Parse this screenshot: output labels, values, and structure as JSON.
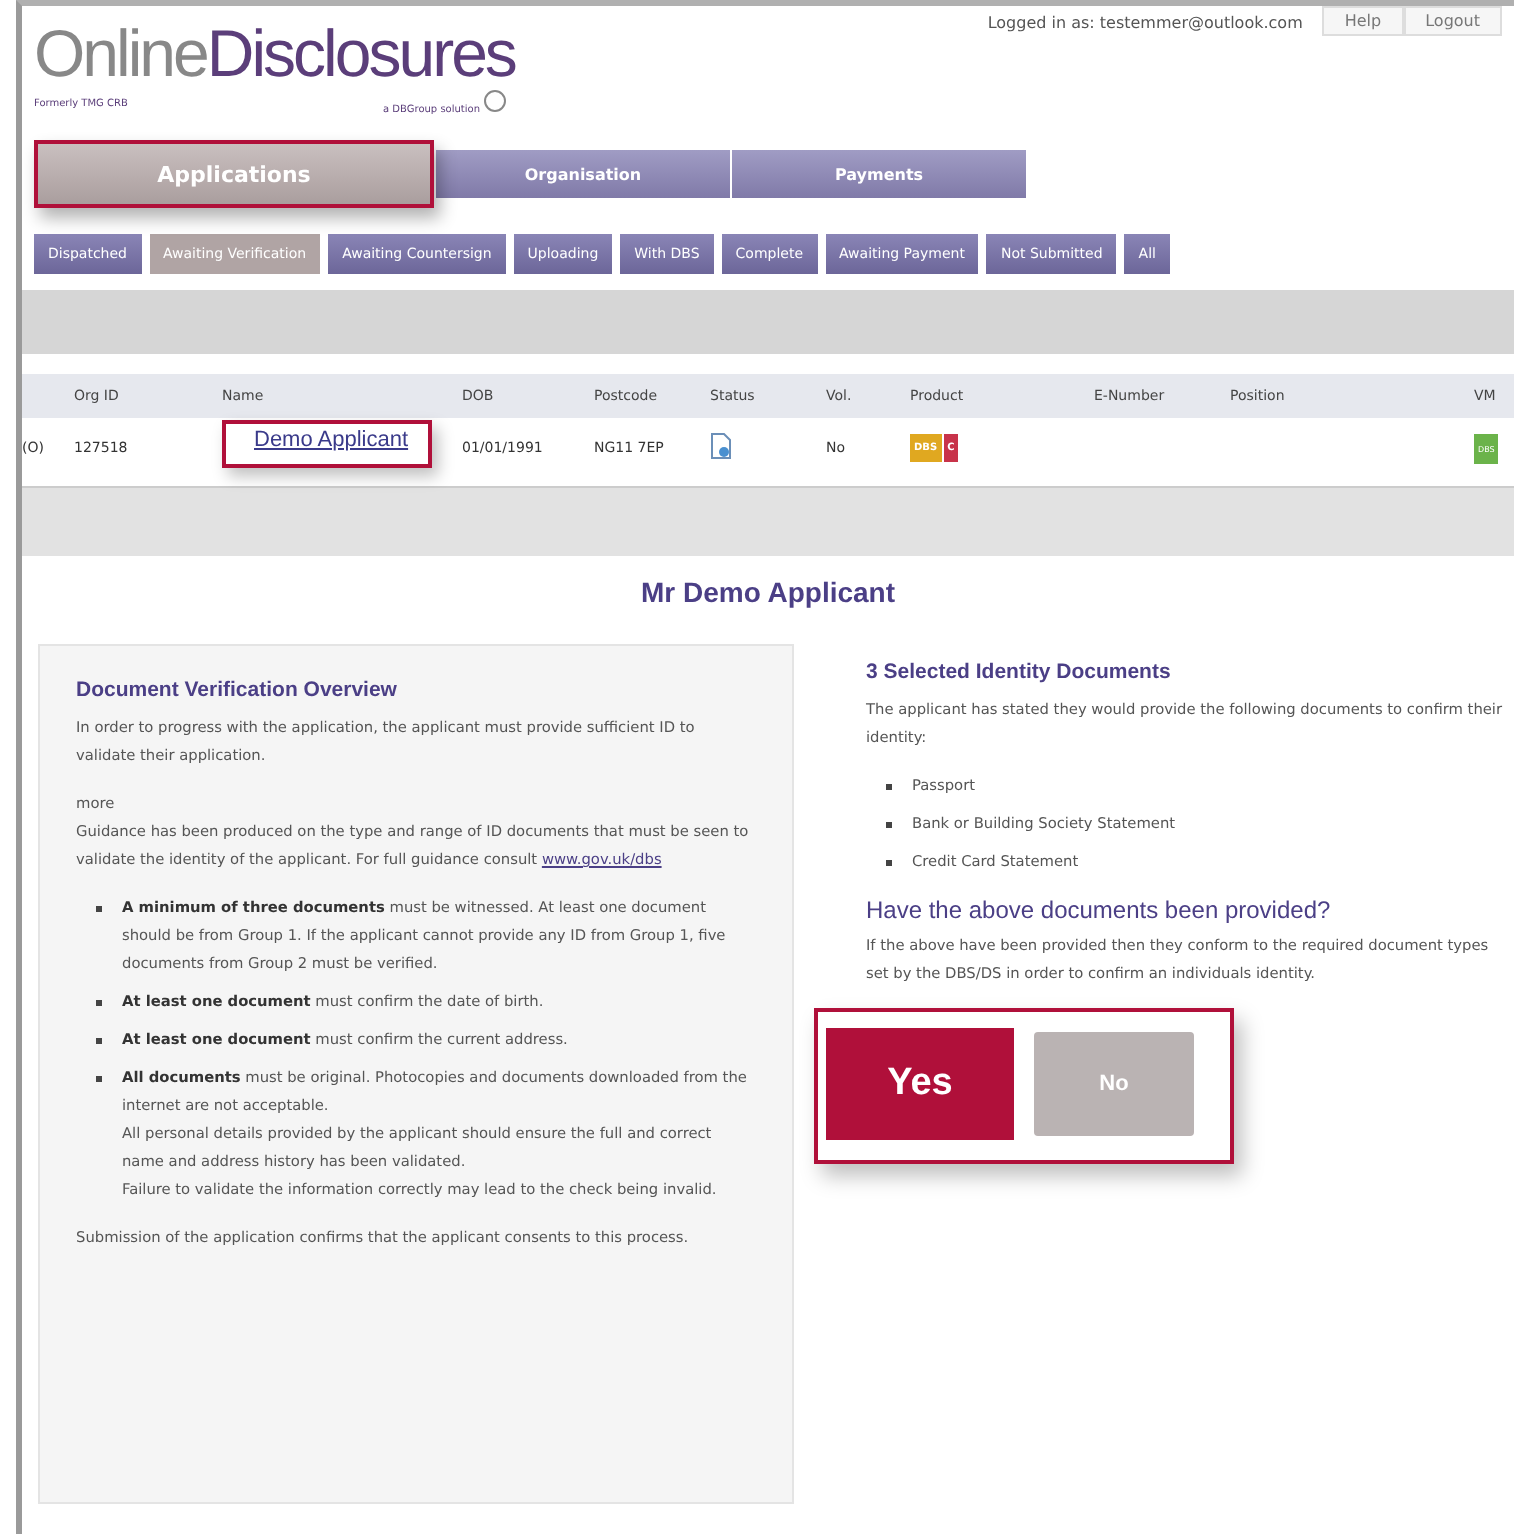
{
  "header": {
    "logo": {
      "main": "Online",
      "accent": "Disclosures",
      "formerly": "Formerly TMG CRB",
      "tagline": "a DBGroup solution"
    },
    "account": "Logged in as: testemmer@outlook.com",
    "links": [
      "Help",
      "Logout"
    ]
  },
  "main_tabs": [
    {
      "label": "Applications",
      "selected": true
    },
    {
      "label": "Organisation",
      "selected": false
    },
    {
      "label": "Payments",
      "selected": false
    }
  ],
  "sub_tabs": [
    {
      "label": "Dispatched",
      "selected": false
    },
    {
      "label": "Awaiting Verification",
      "selected": true
    },
    {
      "label": "Awaiting Countersign",
      "selected": false
    },
    {
      "label": "Uploading",
      "selected": false
    },
    {
      "label": "With DBS",
      "selected": false
    },
    {
      "label": "Complete",
      "selected": false
    },
    {
      "label": "Awaiting Payment",
      "selected": false
    },
    {
      "label": "Not Submitted",
      "selected": false
    },
    {
      "label": "All",
      "selected": false
    }
  ],
  "table": {
    "columns": [
      "Org ID",
      "Name",
      "DOB",
      "Postcode",
      "Status",
      "Vol.",
      "Product",
      "E-Number",
      "Position",
      "VM"
    ],
    "rows": [
      {
        "prefix": "(O)",
        "org_id": "127518",
        "name": "Demo Applicant",
        "dob": "01/01/1991",
        "postcode": "NG11 7EP",
        "vol": "No",
        "products": [
          {
            "label": "DBS",
            "color": "#e0a820"
          },
          {
            "label": "C",
            "color": "#c8334a"
          }
        ],
        "vm": "DBS"
      }
    ]
  },
  "applicant_title": "Mr Demo Applicant",
  "overview": {
    "title": "Document Verification Overview",
    "intro": "In order to progress with the application, the applicant must provide sufficient ID to validate their application.",
    "more": "more",
    "guidance": "Guidance has been produced on the type and range of ID documents that must be seen to validate the identity of the applicant. For full guidance consult",
    "link": "www.gov.uk/dbs",
    "rules": [
      {
        "lines": [
          "**A minimum of three documents** must be witnessed. At least one document should be from Group 1. If the applicant cannot provide any ID from Group 1, five documents from Group 2 must be verified."
        ]
      },
      {
        "lines": [
          "**At least one document** must confirm the date of birth."
        ]
      },
      {
        "lines": [
          "**At least one document** must confirm the current address."
        ]
      },
      {
        "lines": [
          "**All documents** must be original. Photocopies and documents downloaded from the internet are not acceptable.",
          "All personal details  provided by the applicant should ensure the full and correct name and address history has been validated.",
          "Failure to validate the information correctly may lead to the check being invalid."
        ]
      }
    ],
    "footer": "Submission of the application confirms that the applicant consents to this process."
  },
  "identity": {
    "title": "3 Selected Identity Documents",
    "intro": "The applicant has stated they would provide the following documents to confirm their identity:",
    "documents": [
      "Passport",
      "Bank or Building Society Statement",
      "Credit Card Statement"
    ],
    "question": "Have the above documents been provided?",
    "note": "If the above have been provided then they conform to the required document types set by the DBS/DS in order to confirm an individuals identity.",
    "answers": [
      {
        "label": "Yes",
        "selected": true
      },
      {
        "label": "No",
        "selected": false
      }
    ]
  }
}
